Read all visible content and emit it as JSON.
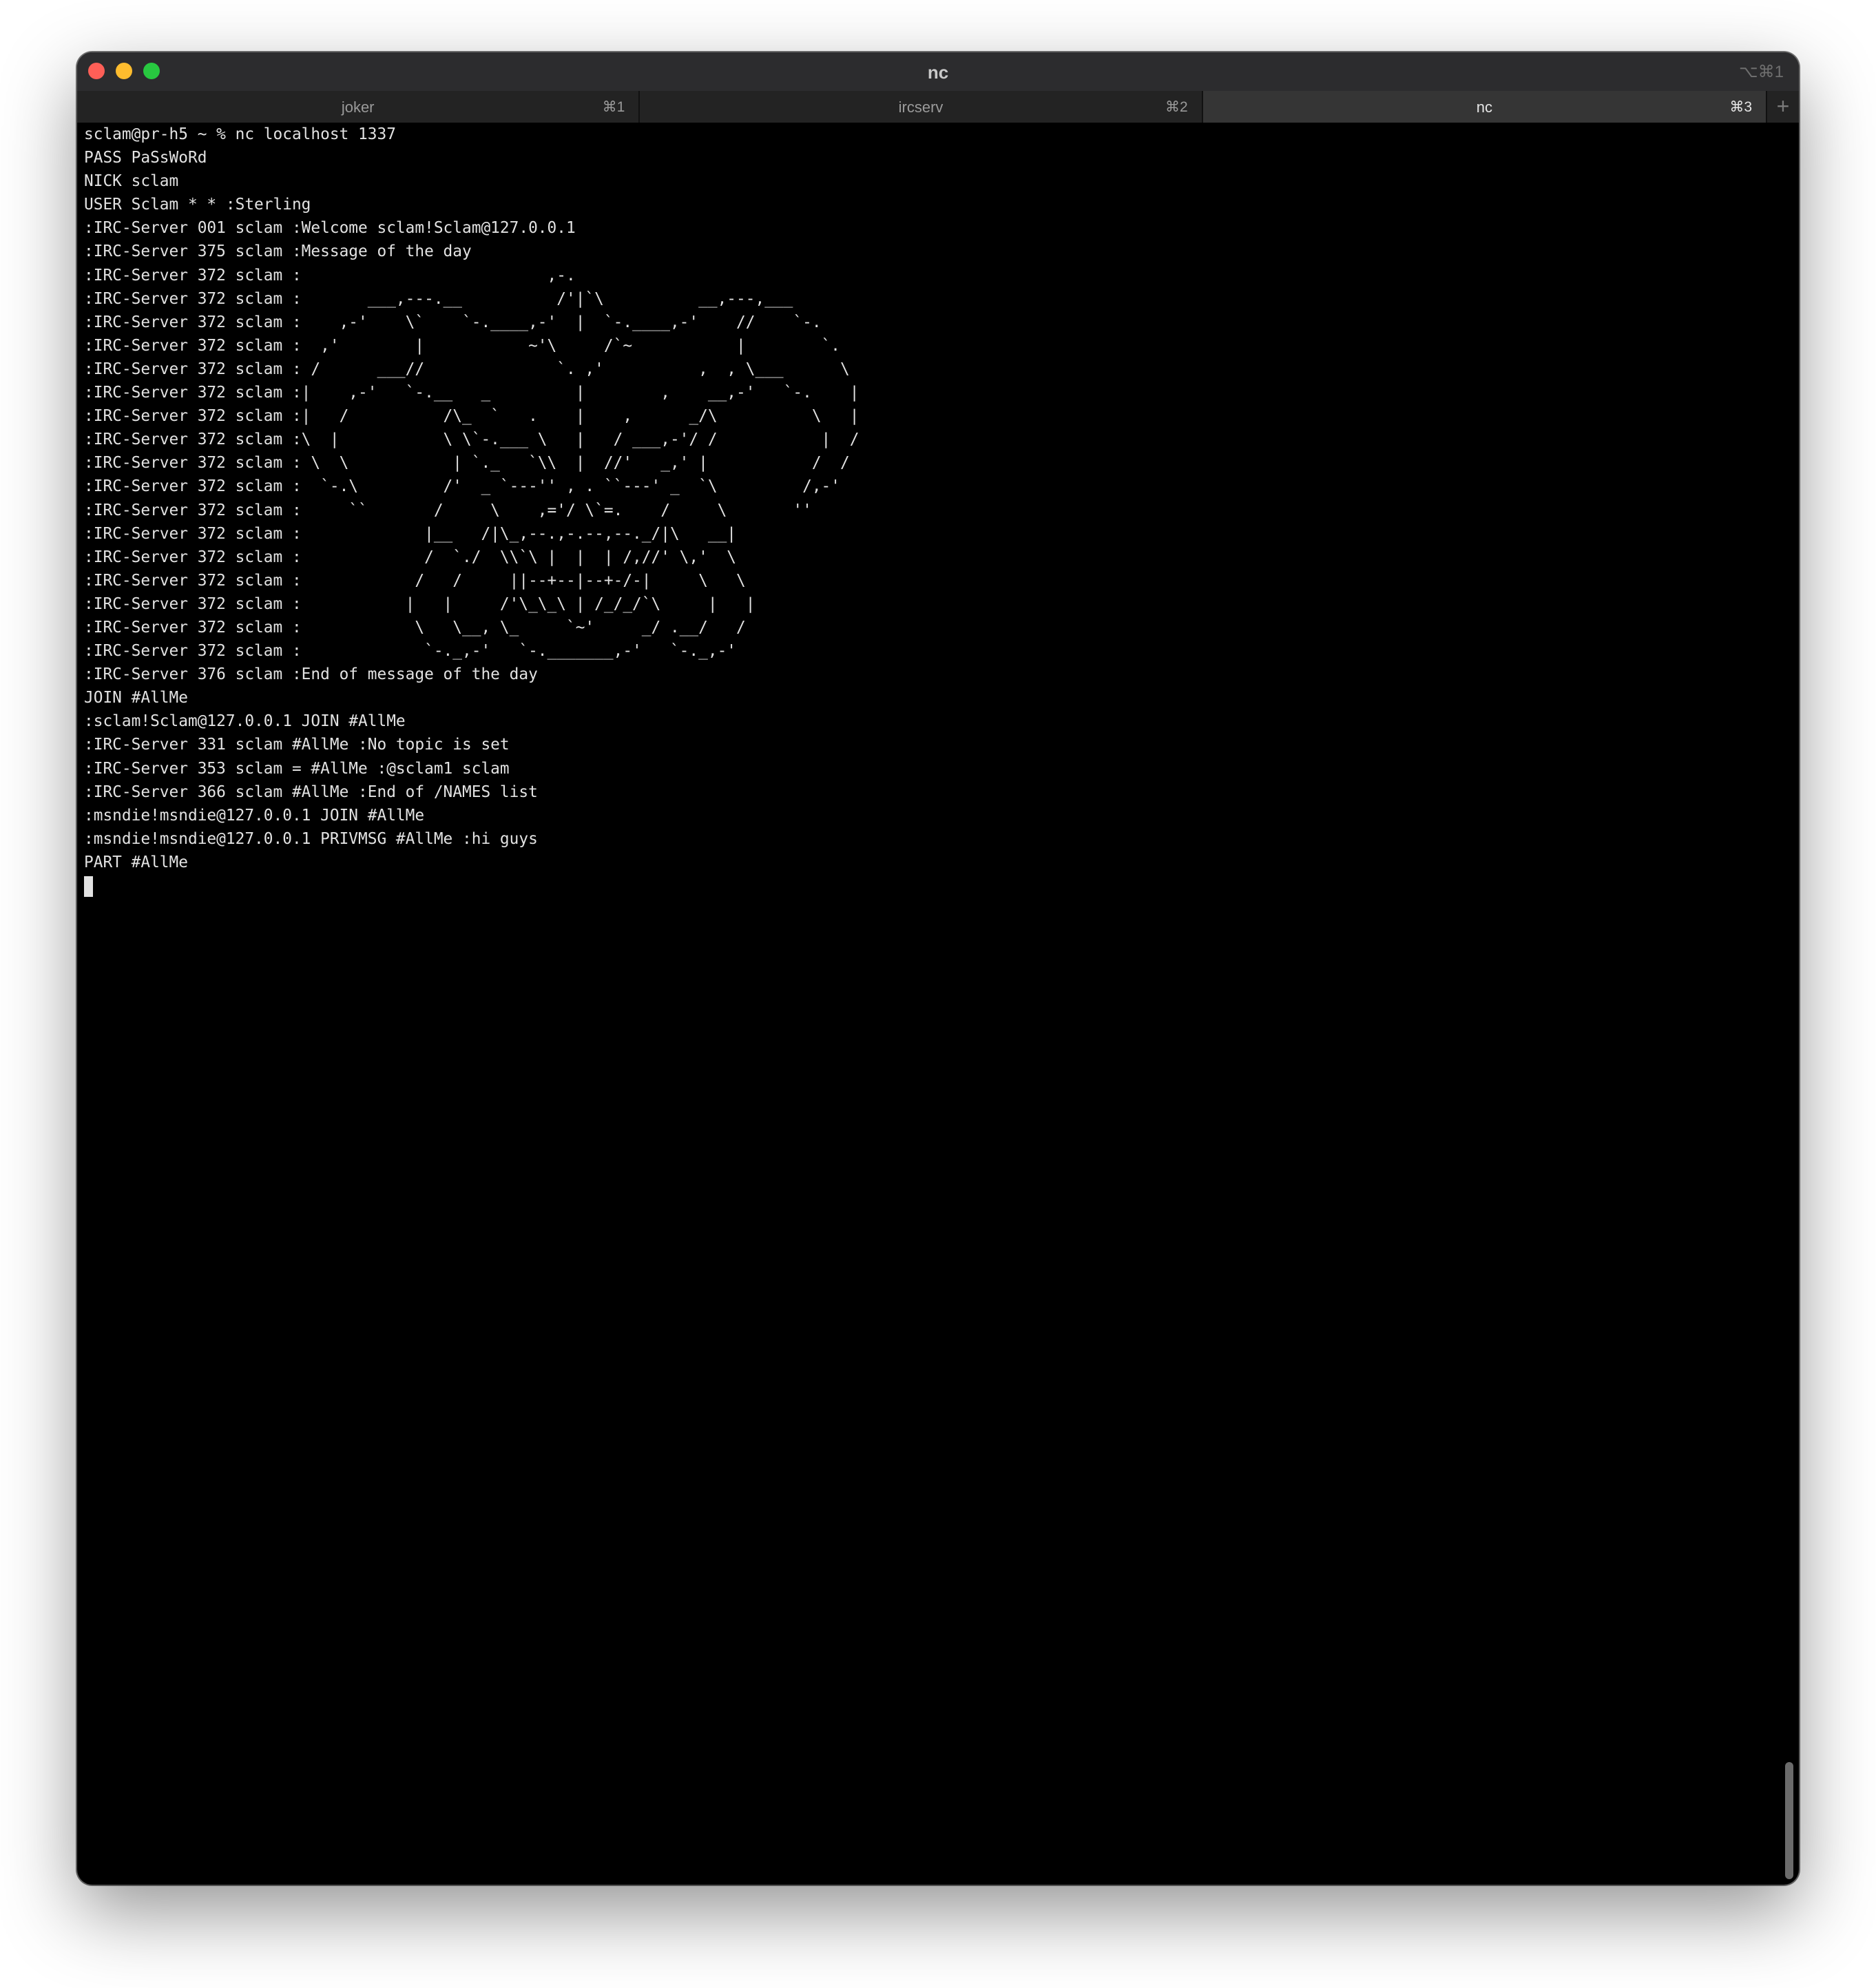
{
  "window": {
    "title": "nc",
    "shortcut": "⌥⌘1"
  },
  "tabs": [
    {
      "label": "joker",
      "shortcut": "⌘1",
      "active": false
    },
    {
      "label": "ircserv",
      "shortcut": "⌘2",
      "active": false
    },
    {
      "label": "nc",
      "shortcut": "⌘3",
      "active": true
    }
  ],
  "new_tab_label": "+",
  "terminal": {
    "lines": [
      "sclam@pr-h5 ~ % nc localhost 1337",
      "PASS PaSsWoRd",
      "NICK sclam",
      "USER Sclam * * :Sterling",
      ":IRC-Server 001 sclam :Welcome sclam!Sclam@127.0.0.1",
      ":IRC-Server 375 sclam :Message of the day",
      ":IRC-Server 372 sclam :                          ,-.",
      ":IRC-Server 372 sclam :       ___,---.__          /'|`\\          __,---,___",
      ":IRC-Server 372 sclam :    ,-'    \\`    `-.____,-'  |  `-.____,-'    //    `-.",
      ":IRC-Server 372 sclam :  ,'        |           ~'\\     /`~           |        `.",
      ":IRC-Server 372 sclam : /      ___//              `. ,'          ,  , \\___      \\",
      ":IRC-Server 372 sclam :|    ,-'   `-.__   _         |        ,    __,-'   `-.    |",
      ":IRC-Server 372 sclam :|   /          /\\_  `   .    |    ,      _/\\          \\   |",
      ":IRC-Server 372 sclam :\\  |           \\ \\`-.___ \\   |   / ___,-'/ /           |  /",
      ":IRC-Server 372 sclam : \\  \\           | `._   `\\\\  |  //'   _,' |           /  /",
      ":IRC-Server 372 sclam :  `-.\\         /'  _ `---'' , . ``---' _  `\\         /,-'",
      ":IRC-Server 372 sclam :     ``       /     \\    ,='/ \\`=.    /     \\       ''",
      ":IRC-Server 372 sclam :             |__   /|\\_,--.,-.--,--._/|\\   __|",
      ":IRC-Server 372 sclam :             /  `./  \\\\`\\ |  |  | /,//' \\,'  \\",
      ":IRC-Server 372 sclam :            /   /     ||--+--|--+-/-|     \\   \\",
      ":IRC-Server 372 sclam :           |   |     /'\\_\\_\\ | /_/_/`\\     |   |",
      ":IRC-Server 372 sclam :            \\   \\__, \\_     `~'     _/ .__/   /",
      ":IRC-Server 372 sclam :             `-._,-'   `-._______,-'   `-._,-'",
      ":IRC-Server 376 sclam :End of message of the day",
      "JOIN #AllMe",
      ":sclam!Sclam@127.0.0.1 JOIN #AllMe",
      ":IRC-Server 331 sclam #AllMe :No topic is set",
      ":IRC-Server 353 sclam = #AllMe :@sclam1 sclam",
      ":IRC-Server 366 sclam #AllMe :End of /NAMES list",
      ":msndie!msndie@127.0.0.1 JOIN #AllMe",
      ":msndie!msndie@127.0.0.1 PRIVMSG #AllMe :hi guys",
      "PART #AllMe"
    ]
  },
  "colors": {
    "close": "#fe5f57",
    "minimize": "#febc2e",
    "zoom": "#28c840",
    "terminal_bg": "#000000",
    "terminal_fg": "#e2e2e2"
  }
}
